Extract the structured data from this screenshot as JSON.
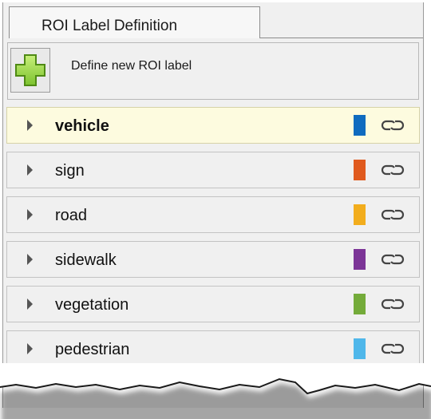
{
  "tab": {
    "label": "ROI Label Definition"
  },
  "toolbar": {
    "add_label": "Define new ROI label",
    "add_icon": "plus-icon"
  },
  "labels": [
    {
      "name": "vehicle",
      "color": "#0f6bbf",
      "selected": true
    },
    {
      "name": "sign",
      "color": "#e05a1e",
      "selected": false
    },
    {
      "name": "road",
      "color": "#f2ad1d",
      "selected": false
    },
    {
      "name": "sidewalk",
      "color": "#7c3597",
      "selected": false
    },
    {
      "name": "vegetation",
      "color": "#74ab3a",
      "selected": false
    },
    {
      "name": "pedestrian",
      "color": "#4fb7ea",
      "selected": false
    }
  ],
  "row_icons": {
    "expand": "expand-arrow-icon",
    "action": "link-icon"
  }
}
